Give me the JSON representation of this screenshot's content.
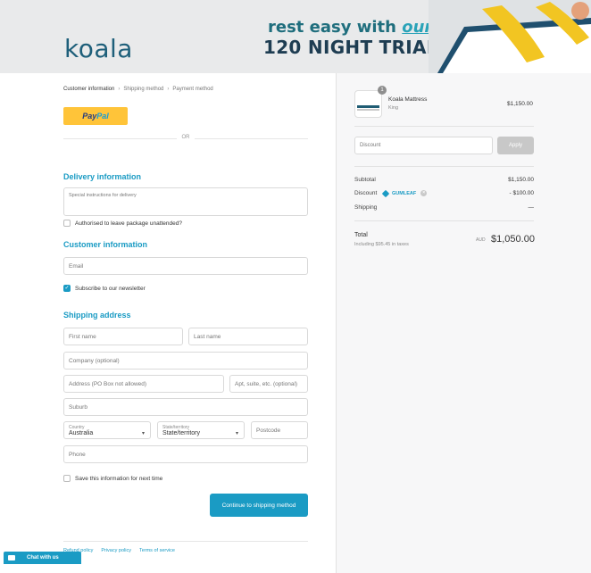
{
  "banner": {
    "logo": "koala",
    "promo_line1_a": "rest easy with",
    "promo_line1_b": "our",
    "promo_line2": "120 NIGHT TRIAL"
  },
  "breadcrumb": {
    "items": [
      "Customer information",
      "Shipping method",
      "Payment method"
    ]
  },
  "express": {
    "paypal_a": "Pay",
    "paypal_b": "Pal",
    "or": "OR"
  },
  "delivery": {
    "heading": "Delivery information",
    "instructions_placeholder": "Special instructions for delivery",
    "unattended_label": "Authorised to leave package unattended?"
  },
  "customer": {
    "heading": "Customer information",
    "email_placeholder": "Email",
    "newsletter_label": "Subscribe to our newsletter"
  },
  "shipping": {
    "heading": "Shipping address",
    "first_name": "First name",
    "last_name": "Last name",
    "company": "Company (optional)",
    "address": "Address (PO Box not allowed)",
    "apt": "Apt, suite, etc. (optional)",
    "suburb": "Suburb",
    "country_label": "Country",
    "country_value": "Australia",
    "state_label": "State/territory",
    "state_value": "State/territory",
    "postcode": "Postcode",
    "phone": "Phone",
    "save_label": "Save this information for next time",
    "continue_button": "Continue to shipping method"
  },
  "footer": {
    "links": [
      "Refund policy",
      "Privacy policy",
      "Terms of service"
    ]
  },
  "chat": {
    "label": "Chat with us"
  },
  "summary": {
    "qty": "1",
    "product_name": "Koala Mattress",
    "product_variant": "King",
    "product_price": "$1,150.00",
    "discount_placeholder": "Discount",
    "apply_button": "Apply",
    "subtotal_label": "Subtotal",
    "subtotal_value": "$1,150.00",
    "discount_label": "Discount",
    "discount_code": "GUMLEAF",
    "discount_value": "- $100.00",
    "shipping_label": "Shipping",
    "shipping_value": "—",
    "total_label": "Total",
    "total_tax": "Including $95.45 in taxes",
    "total_currency": "AUD",
    "total_value": "$1,050.00"
  },
  "colors": {
    "accent": "#1a9bc4",
    "paypal": "#ffc439",
    "logo": "#1e5f7a"
  }
}
